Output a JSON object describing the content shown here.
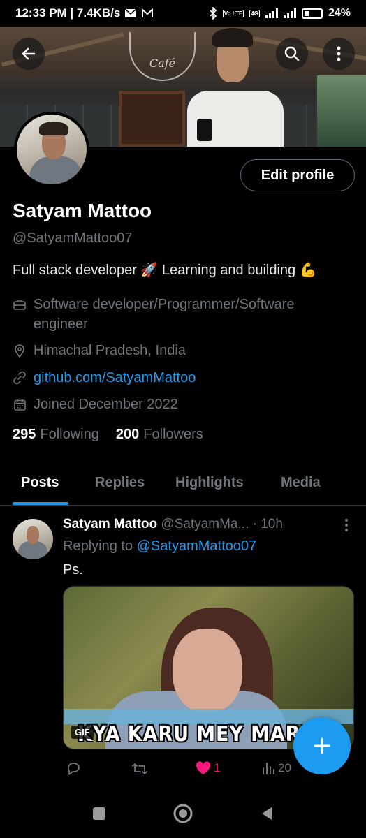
{
  "status_bar": {
    "time_speed": "12:33 PM | 7.4KB/s",
    "network_tag": "4G",
    "volte_tag": "Vo LTE",
    "battery": "24%"
  },
  "cover": {
    "cafe_sign": "Café"
  },
  "profile": {
    "edit_label": "Edit profile",
    "name": "Satyam Mattoo",
    "handle": "@SatyamMattoo07",
    "bio": "Full stack developer 🚀 Learning and building 💪",
    "profession_line1": "Software developer/Programmer/Software",
    "profession_line2": "engineer",
    "location": "Himachal Pradesh, India",
    "website": "github.com/SatyamMattoo",
    "joined": "Joined December 2022",
    "following_count": "295",
    "following_label": "Following",
    "followers_count": "200",
    "followers_label": "Followers"
  },
  "tabs": [
    {
      "label": "Posts",
      "active": true
    },
    {
      "label": "Replies",
      "active": false
    },
    {
      "label": "Highlights",
      "active": false
    },
    {
      "label": "Media",
      "active": false
    }
  ],
  "tweet": {
    "author": "Satyam Mattoo",
    "handle_time": "@SatyamMa... · 10h",
    "replying_prefix": "Replying to",
    "replying_to": "@SatyamMattoo07",
    "text": "Ps.",
    "gif_badge": "GIF",
    "gif_caption": "KYA KARU MEY MARJA",
    "likes": "1",
    "views": "20"
  },
  "colors": {
    "accent": "#1d9bf0",
    "like": "#f91880",
    "muted": "#71767b"
  },
  "icons": {
    "back": "arrow-left-icon",
    "search": "search-icon",
    "more": "more-vertical-icon",
    "compose": "plus-icon"
  }
}
